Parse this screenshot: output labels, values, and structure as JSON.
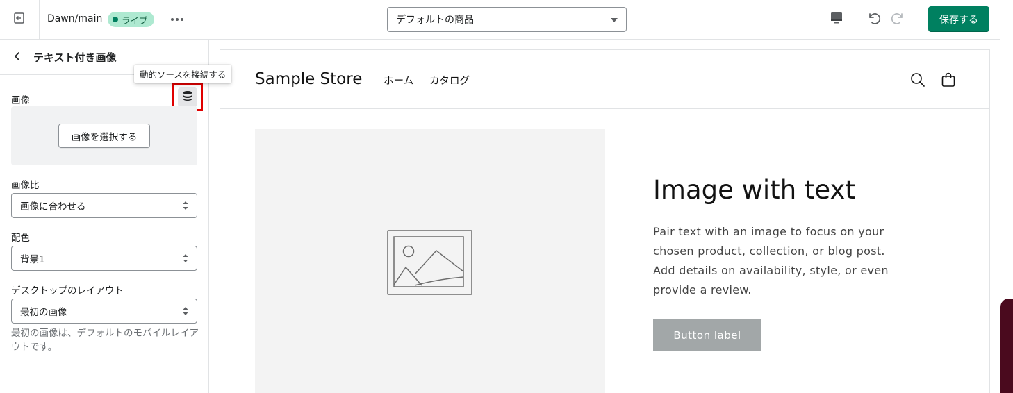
{
  "topbar": {
    "theme_name": "Dawn/main",
    "live_badge": "ライブ",
    "template_select": "デフォルトの商品",
    "save_label": "保存する"
  },
  "sidebar": {
    "title": "テキスト付き画像",
    "tooltip": "動的ソースを接続する",
    "image_label": "画像",
    "select_image_button": "画像を選択する",
    "ratio_label": "画像比",
    "ratio_value": "画像に合わせる",
    "color_label": "配色",
    "color_value": "背景1",
    "layout_label": "デスクトップのレイアウト",
    "layout_value": "最初の画像",
    "layout_help": "最初の画像は、デフォルトのモバイルレイアウトです。"
  },
  "preview": {
    "store_name": "Sample Store",
    "nav": [
      "ホーム",
      "カタログ"
    ],
    "heading": "Image with text",
    "body": "Pair text with an image to focus on your chosen product, collection, or blog post. Add details on availability, style, or even provide a review.",
    "button_label": "Button label"
  },
  "colors": {
    "accent": "#008060",
    "live_badge_bg": "#aee9d1",
    "highlight": "#e00000",
    "preview_button": "#a2a7a8"
  },
  "icons": [
    "exit-icon",
    "more-icon",
    "desktop-icon",
    "undo-icon",
    "redo-icon",
    "back-icon",
    "database-icon",
    "search-icon",
    "cart-icon",
    "image-placeholder-icon"
  ]
}
